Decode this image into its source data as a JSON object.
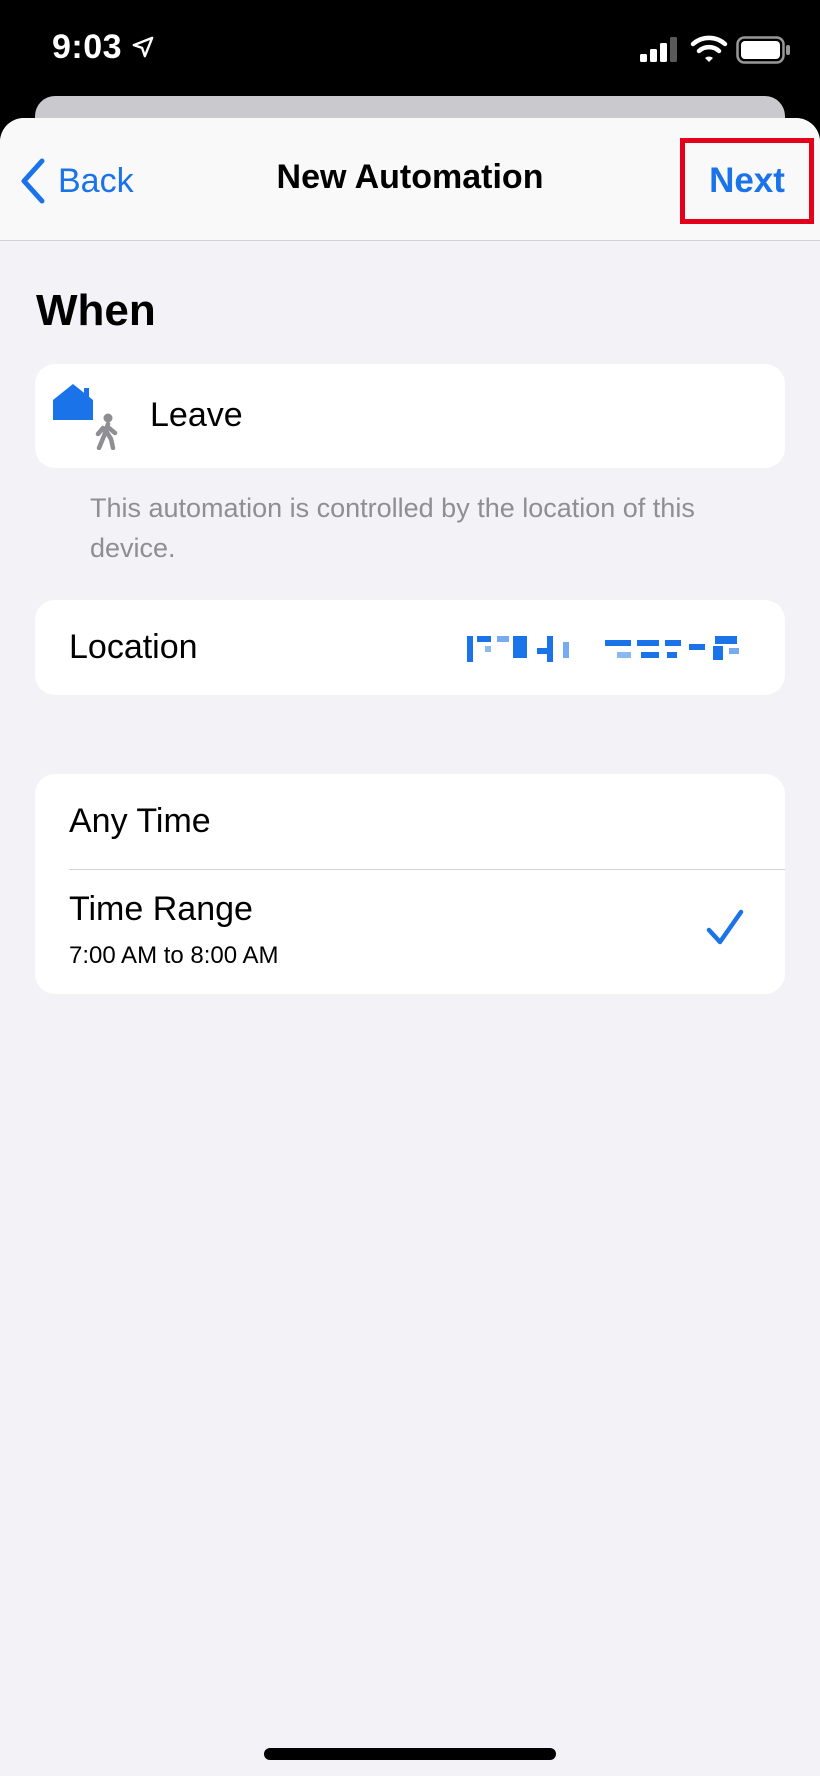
{
  "status_bar": {
    "time": "9:03",
    "icons": [
      "location-arrow-icon",
      "cellular-signal-icon",
      "wifi-icon",
      "battery-icon"
    ]
  },
  "nav": {
    "back_label": "Back",
    "title": "New Automation",
    "next_label": "Next",
    "highlight_color": "#e4001b"
  },
  "main": {
    "section_heading": "When",
    "trigger": {
      "label": "Leave",
      "icon": "home-leave-icon"
    },
    "footnote": "This automation is controlled by the location of this device.",
    "location": {
      "label": "Location"
    },
    "time_options": [
      {
        "label": "Any Time",
        "selected": false
      },
      {
        "label": "Time Range",
        "detail": "7:00 AM to 8:00 AM",
        "selected": true
      }
    ]
  },
  "colors": {
    "accent": "#1a73e8",
    "background": "#f2f2f7",
    "secondary_text": "#8e8e93"
  }
}
